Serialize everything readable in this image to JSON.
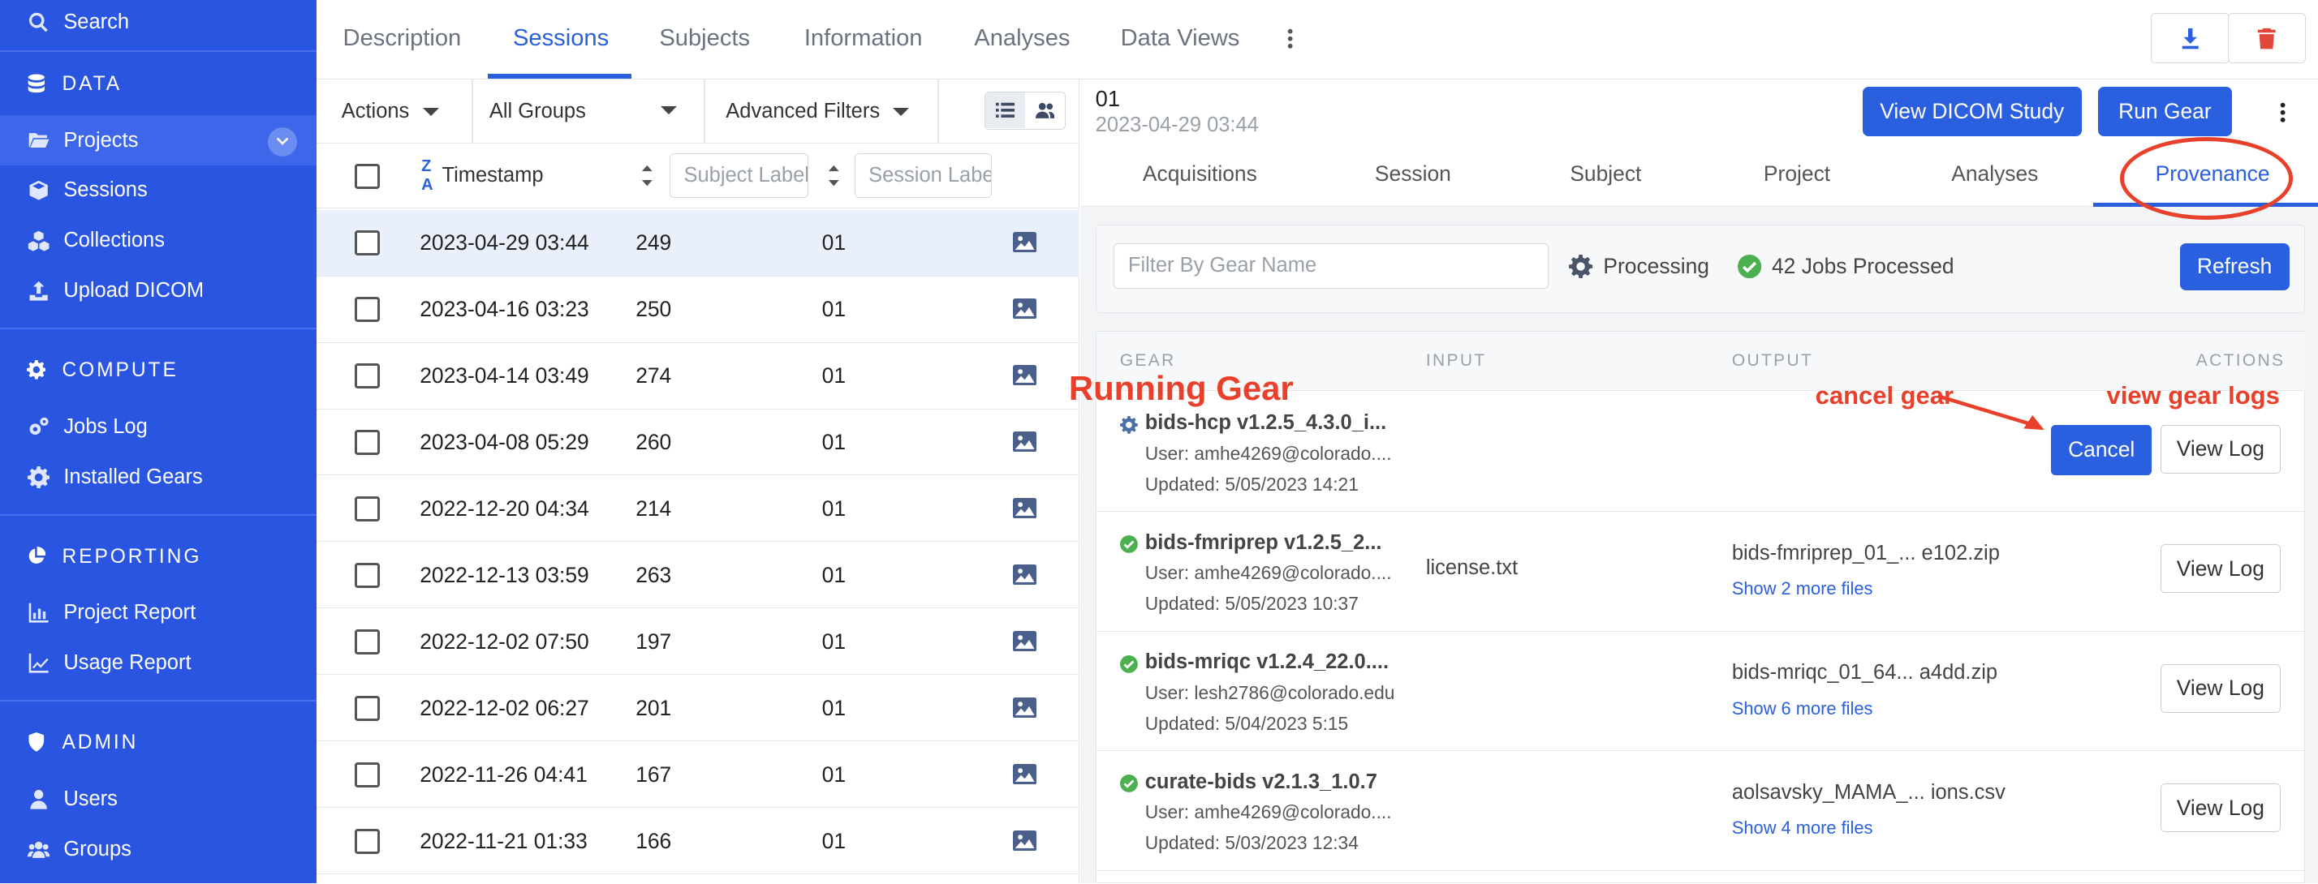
{
  "sidebar": {
    "search": "Search",
    "data_section": "DATA",
    "projects": "Projects",
    "sessions": "Sessions",
    "collections": "Collections",
    "upload_dicom": "Upload DICOM",
    "compute_section": "COMPUTE",
    "jobs_log": "Jobs Log",
    "installed_gears": "Installed Gears",
    "reporting_section": "REPORTING",
    "project_report": "Project Report",
    "usage_report": "Usage Report",
    "admin_section": "ADMIN",
    "users": "Users",
    "groups": "Groups"
  },
  "top_tabs": {
    "description": "Description",
    "sessions": "Sessions",
    "subjects": "Subjects",
    "information": "Information",
    "analyses": "Analyses",
    "data_views": "Data Views"
  },
  "toolbar": {
    "actions": "Actions",
    "groups": "All Groups",
    "filters": "Advanced Filters"
  },
  "table": {
    "ts_header": "Timestamp",
    "subject_placeholder": "Subject Label",
    "session_placeholder": "Session Label",
    "rows": [
      {
        "ts": "2023-04-29 03:44",
        "subject": "249",
        "session": "01"
      },
      {
        "ts": "2023-04-16 03:23",
        "subject": "250",
        "session": "01"
      },
      {
        "ts": "2023-04-14 03:49",
        "subject": "274",
        "session": "01"
      },
      {
        "ts": "2023-04-08 05:29",
        "subject": "260",
        "session": "01"
      },
      {
        "ts": "2022-12-20 04:34",
        "subject": "214",
        "session": "01"
      },
      {
        "ts": "2022-12-13 03:59",
        "subject": "263",
        "session": "01"
      },
      {
        "ts": "2022-12-02 07:50",
        "subject": "197",
        "session": "01"
      },
      {
        "ts": "2022-12-02 06:27",
        "subject": "201",
        "session": "01"
      },
      {
        "ts": "2022-11-26 04:41",
        "subject": "167",
        "session": "01"
      },
      {
        "ts": "2022-11-21 01:33",
        "subject": "166",
        "session": "01"
      }
    ]
  },
  "detail": {
    "title": "01",
    "date": "2023-04-29 03:44",
    "view_dicom": "View DICOM Study",
    "run_gear": "Run Gear",
    "tabs": {
      "acquisitions": "Acquisitions",
      "session": "Session",
      "subject": "Subject",
      "project": "Project",
      "analyses": "Analyses",
      "provenance": "Provenance"
    },
    "filter_placeholder": "Filter By Gear Name",
    "processing": "Processing",
    "jobs_processed": "42 Jobs Processed",
    "refresh": "Refresh",
    "col_gear": "GEAR",
    "col_input": "INPUT",
    "col_output": "OUTPUT",
    "col_actions": "ACTIONS",
    "jobs": [
      {
        "name": "bids-hcp v1.2.5_4.3.0_i...",
        "user": "User: amhe4269@colorado....",
        "updated": "Updated: 5/05/2023 14:21",
        "input": "",
        "output": "",
        "more": "",
        "cancel": "Cancel",
        "log": "View Log"
      },
      {
        "name": "bids-fmriprep v1.2.5_2...",
        "user": "User: amhe4269@colorado....",
        "updated": "Updated: 5/05/2023 10:37",
        "input": "license.txt",
        "output": "bids-fmriprep_01_... e102.zip",
        "more": "Show 2 more files",
        "log": "View Log"
      },
      {
        "name": "bids-mriqc v1.2.4_22.0....",
        "user": "User: lesh2786@colorado.edu",
        "updated": "Updated: 5/04/2023 5:15",
        "input": "",
        "output": "bids-mriqc_01_64... a4dd.zip",
        "more": "Show 6 more files",
        "log": "View Log"
      },
      {
        "name": "curate-bids v2.1.3_1.0.7",
        "user": "User: amhe4269@colorado....",
        "updated": "Updated: 5/03/2023 12:34",
        "input": "",
        "output": "aolsavsky_MAMA_... ions.csv",
        "more": "Show 4 more files",
        "log": "View Log"
      }
    ]
  },
  "annotations": {
    "running_gear": "Running Gear",
    "cancel_gear": "cancel gear",
    "view_gear_logs": "view gear logs",
    "color": "#e8402a"
  },
  "colors": {
    "sidebar": "#2a55e0",
    "accent": "#2a5fe0",
    "success": "#4caf50"
  }
}
